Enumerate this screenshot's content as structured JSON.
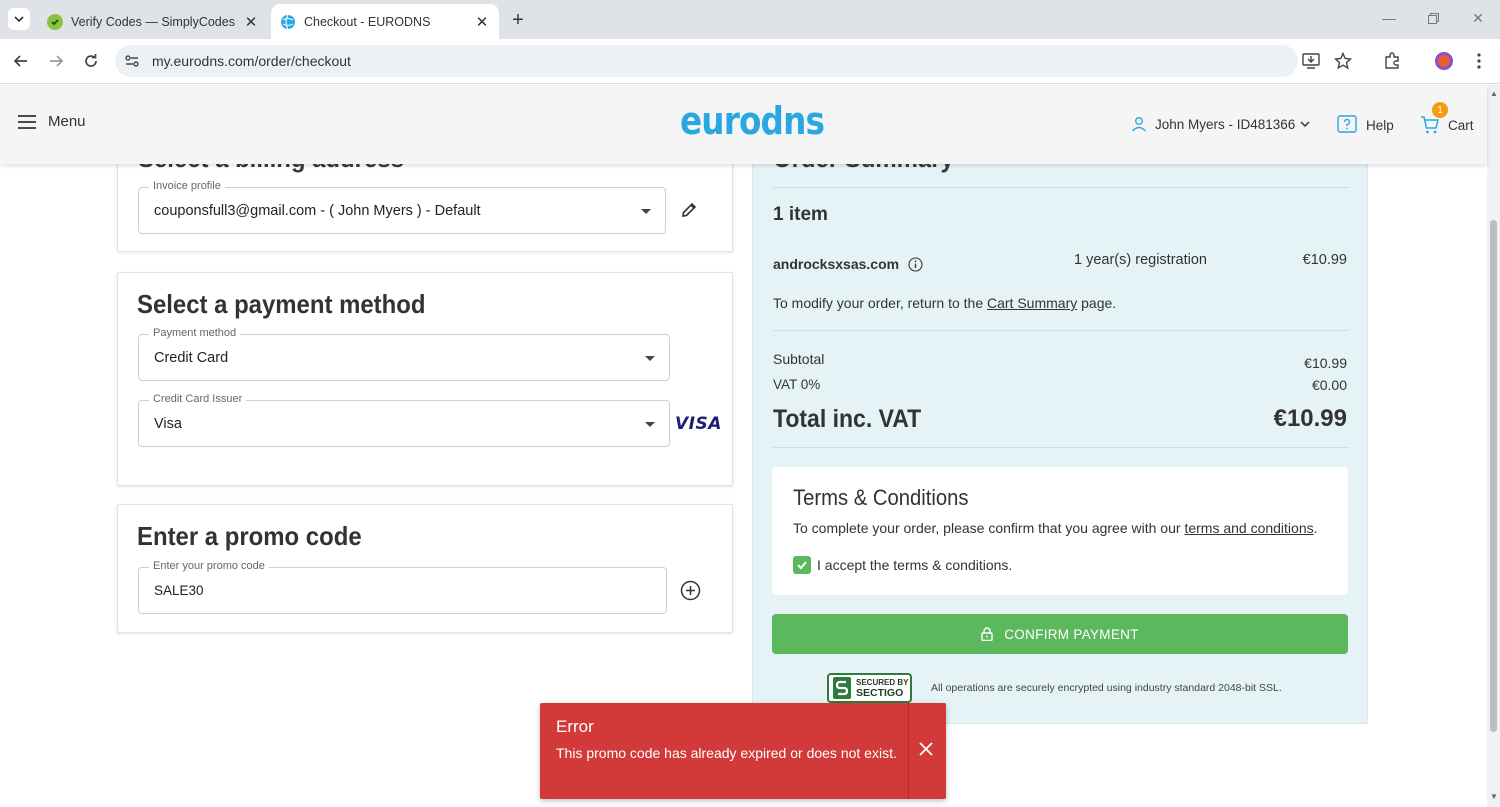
{
  "browser": {
    "tabs": [
      {
        "title": "Verify Codes — SimplyCodes",
        "active": false
      },
      {
        "title": "Checkout - EURODNS",
        "active": true
      }
    ],
    "url": "my.eurodns.com/order/checkout"
  },
  "header": {
    "menu_label": "Menu",
    "logo": "eurodns",
    "user_label": "John Myers - ID481366",
    "help_label": "Help",
    "cart_label": "Cart",
    "cart_count": "1"
  },
  "billing": {
    "heading": "Select a billing address",
    "invoice_label": "Invoice profile",
    "invoice_value": "couponsfull3@gmail.com - ( John Myers ) - Default"
  },
  "payment": {
    "heading": "Select a payment method",
    "method_label": "Payment method",
    "method_value": "Credit Card",
    "issuer_label": "Credit Card Issuer",
    "issuer_value": "Visa",
    "issuer_logo": "VISA"
  },
  "promo": {
    "heading": "Enter a promo code",
    "label": "Enter your promo code",
    "value": "SALE30"
  },
  "summary": {
    "heading": "Order Summary",
    "item_count": "1 item",
    "domain": "androcksxsas.com",
    "registration": "1 year(s) registration",
    "item_price": "€10.99",
    "modify_prefix": "To modify your order, return to the ",
    "modify_link": "Cart Summary",
    "modify_suffix": " page.",
    "subtotal_label": "Subtotal",
    "subtotal_value": "€10.99",
    "vat_label": "VAT 0%",
    "vat_value": "€0.00",
    "total_label": "Total inc. VAT",
    "total_value": "€10.99"
  },
  "terms": {
    "title": "Terms & Conditions",
    "text_prefix": "To complete your order, please confirm that you agree with our ",
    "text_link": "terms and conditions",
    "text_suffix": ".",
    "accept_label": "I accept the terms & conditions.",
    "accepted": true
  },
  "confirm_label": "CONFIRM PAYMENT",
  "security": {
    "badge_line1": "SECURED BY",
    "badge_line2": "SECTIGO",
    "note": "All operations are securely encrypted using industry standard 2048-bit SSL."
  },
  "toast": {
    "title": "Error",
    "message": "This promo code has already expired or does not exist."
  },
  "colors": {
    "brand": "#29a8e0",
    "confirm": "#5cb85c",
    "error": "#d23a3a",
    "summary_bg": "#e6f3f6",
    "badge": "#f39c12"
  }
}
